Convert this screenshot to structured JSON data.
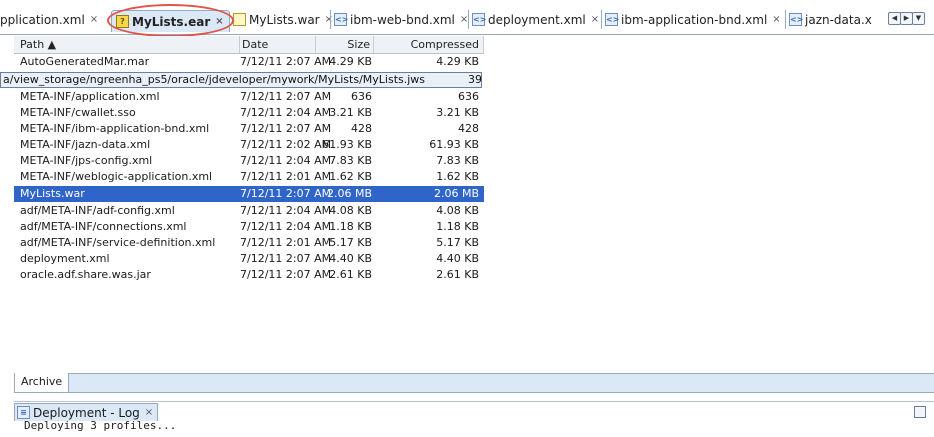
{
  "tabs": [
    {
      "label": "pplication.xml",
      "icon": "xml-file-icon"
    },
    {
      "label": "MyLists.ear",
      "icon": "ear-file-icon",
      "active": true
    },
    {
      "label": "MyLists.war",
      "icon": "war-file-icon"
    },
    {
      "label": "ibm-web-bnd.xml",
      "icon": "xml-file-icon"
    },
    {
      "label": "deployment.xml",
      "icon": "xml-file-icon"
    },
    {
      "label": "ibm-application-bnd.xml",
      "icon": "xml-file-icon"
    },
    {
      "label": "jazn-data.x",
      "icon": "xml-file-icon"
    }
  ],
  "close_glyph": "×",
  "table": {
    "columns": {
      "path": "Path ▲",
      "date": "Date",
      "size": "Size",
      "compressed": "Compressed"
    },
    "tooltip": "a/view_storage/ngreenha_ps5/oracle/jdeveloper/mywork/MyLists/MyLists.jws",
    "tooltip_tail": "39",
    "rows": [
      {
        "path": "AutoGeneratedMar.mar",
        "date": "7/12/11 2:07 AM",
        "size": "4.29 KB",
        "compressed": "4.29 KB"
      },
      {
        "path": "",
        "date": "",
        "size": "",
        "compressed": ""
      },
      {
        "path": "META-INF/application.xml",
        "date": "7/12/11 2:07 AM",
        "size": "636",
        "compressed": "636"
      },
      {
        "path": "META-INF/cwallet.sso",
        "date": "7/12/11 2:04 AM",
        "size": "3.21 KB",
        "compressed": "3.21 KB"
      },
      {
        "path": "META-INF/ibm-application-bnd.xml",
        "date": "7/12/11 2:07 AM",
        "size": "428",
        "compressed": "428"
      },
      {
        "path": "META-INF/jazn-data.xml",
        "date": "7/12/11 2:02 AM",
        "size": "61.93 KB",
        "compressed": "61.93 KB"
      },
      {
        "path": "META-INF/jps-config.xml",
        "date": "7/12/11 2:04 AM",
        "size": "7.83 KB",
        "compressed": "7.83 KB"
      },
      {
        "path": "META-INF/weblogic-application.xml",
        "date": "7/12/11 2:01 AM",
        "size": "1.62 KB",
        "compressed": "1.62 KB"
      },
      {
        "path": "MyLists.war",
        "date": "7/12/11 2:07 AM",
        "size": "2.06 MB",
        "compressed": "2.06 MB",
        "selected": true
      },
      {
        "path": "adf/META-INF/adf-config.xml",
        "date": "7/12/11 2:04 AM",
        "size": "4.08 KB",
        "compressed": "4.08 KB"
      },
      {
        "path": "adf/META-INF/connections.xml",
        "date": "7/12/11 2:04 AM",
        "size": "1.18 KB",
        "compressed": "1.18 KB"
      },
      {
        "path": "adf/META-INF/service-definition.xml",
        "date": "7/12/11 2:01 AM",
        "size": "5.17 KB",
        "compressed": "5.17 KB"
      },
      {
        "path": "deployment.xml",
        "date": "7/12/11 2:07 AM",
        "size": "4.40 KB",
        "compressed": "4.40 KB"
      },
      {
        "path": "oracle.adf.share.was.jar",
        "date": "7/12/11 2:07 AM",
        "size": "2.61 KB",
        "compressed": "2.61 KB"
      }
    ]
  },
  "archive_tab": "Archive",
  "log": {
    "tab": "Deployment - Log",
    "line1": "Deploying 3 profiles..."
  },
  "colors": {
    "selection": "#2f64c8",
    "tab_active": "#dbe8f6",
    "annotation": "#e0544a"
  }
}
